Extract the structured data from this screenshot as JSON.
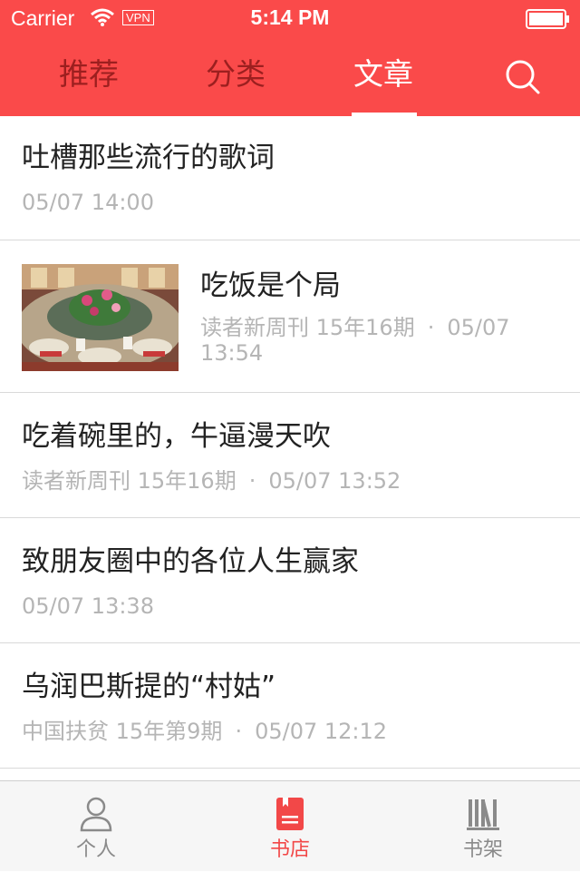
{
  "status_bar": {
    "carrier": "Carrier",
    "vpn": "VPN",
    "time": "5:14 PM"
  },
  "top_tabs": [
    {
      "label": "推荐",
      "active": false
    },
    {
      "label": "分类",
      "active": false
    },
    {
      "label": "文章",
      "active": true
    }
  ],
  "articles": [
    {
      "title": "吐槽那些流行的歌词",
      "source": "",
      "time": "05/07 14:00",
      "has_thumbnail": false
    },
    {
      "title": "吃饭是个局",
      "source": "读者新周刊 15年16期",
      "time": "05/07 13:54",
      "has_thumbnail": true
    },
    {
      "title": "吃着碗里的，牛逼漫天吹",
      "source": "读者新周刊 15年16期",
      "time": "05/07 13:52",
      "has_thumbnail": false
    },
    {
      "title": "致朋友圈中的各位人生赢家",
      "source": "",
      "time": "05/07 13:38",
      "has_thumbnail": false
    },
    {
      "title": "乌润巴斯提的“村姑”",
      "source": "中国扶贫 15年第9期",
      "time": "05/07 12:12",
      "has_thumbnail": false
    }
  ],
  "meta_separator": "·",
  "bottom_tabs": [
    {
      "label": "个人",
      "icon": "person-icon",
      "active": false
    },
    {
      "label": "书店",
      "icon": "bookstore-icon",
      "active": true
    },
    {
      "label": "书架",
      "icon": "bookshelf-icon",
      "active": false
    }
  ],
  "colors": {
    "header": "#fa4a4a",
    "inactive_tab": "#9c1f1f",
    "active_tab": "#ffffff",
    "accent": "#f24848",
    "meta_text": "#b5b5b5"
  }
}
